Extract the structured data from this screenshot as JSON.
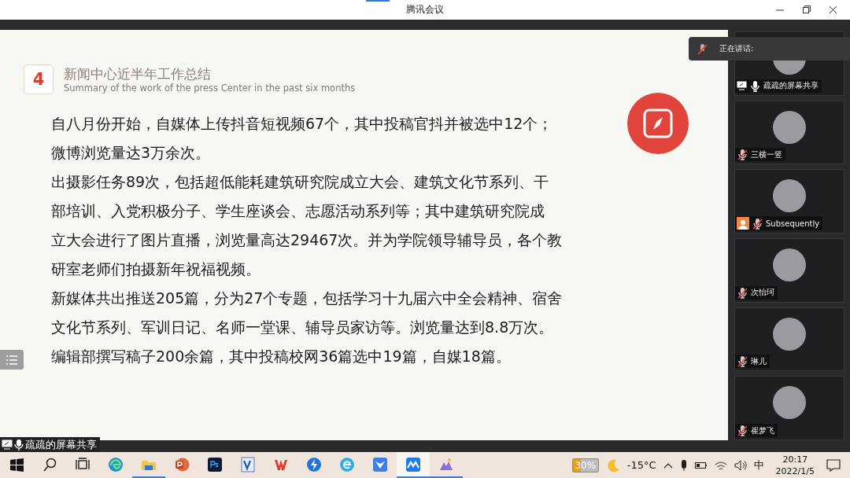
{
  "window": {
    "title": "腾讯会议"
  },
  "slide": {
    "number": "4",
    "title": "新闻中心近半年工作总结",
    "subtitle": "Summary of the work of the press Center in the past six months",
    "paragraphs": [
      {
        "lines": [
          "自八月份开始，自媒体上传抖音短视频67个，其中投稿官抖并被选中12个；",
          "微博浏览量达3万余次。"
        ]
      },
      {
        "lines": [
          "出摄影任务89次，包括超低能耗建筑研究院成立大会、建筑文化节系列、干",
          "部培训、入党积极分子、学生座谈会、志愿活动系列等；其中建筑研究院成",
          "立大会进行了图片直播，浏览量高达29467次。并为学院领导辅导员，各个教",
          "研室老师们拍摄新年祝福视频。"
        ]
      },
      {
        "lines": [
          "新媒体共出推送205篇，分为27个专题，包括学习十九届六中全会精神、宿舍",
          "文化节系列、军训日记、名师一堂课、辅导员家访等。浏览量达到8.8万次。"
        ]
      },
      {
        "lines": [
          "编辑部撰写稿子200余篇，其中投稿校网36篇选中19篇，自媒18篇。"
        ]
      }
    ]
  },
  "speaking_toast": {
    "label": "正在讲话:"
  },
  "participants": [
    {
      "name": "疏疏的屏幕共享",
      "muted": false,
      "sharing": true,
      "host": false
    },
    {
      "name": "三横一竖",
      "muted": true,
      "sharing": false,
      "host": false
    },
    {
      "name": "Subsequently",
      "muted": true,
      "sharing": false,
      "host": true
    },
    {
      "name": "次怡珂",
      "muted": true,
      "sharing": false,
      "host": false
    },
    {
      "name": "琳儿",
      "muted": true,
      "sharing": false,
      "host": false
    },
    {
      "name": "崔梦飞",
      "muted": true,
      "sharing": false,
      "host": false
    }
  ],
  "share_label": {
    "text": "疏疏的屏幕共享"
  },
  "taskbar": {
    "apps": [
      {
        "kind": "start",
        "running": false,
        "selected": false
      },
      {
        "kind": "search",
        "running": false,
        "selected": false
      },
      {
        "kind": "taskview",
        "running": false,
        "selected": false
      },
      {
        "kind": "browser",
        "running": false,
        "selected": false
      },
      {
        "kind": "folder",
        "running": true,
        "selected": false
      },
      {
        "kind": "slides",
        "running": false,
        "selected": false
      },
      {
        "kind": "photo",
        "running": false,
        "selected": false
      },
      {
        "kind": "diagram",
        "running": false,
        "selected": false
      },
      {
        "kind": "office",
        "running": false,
        "selected": false
      },
      {
        "kind": "bolt",
        "running": false,
        "selected": false
      },
      {
        "kind": "globe",
        "running": false,
        "selected": false
      },
      {
        "kind": "bird",
        "running": false,
        "selected": false
      },
      {
        "kind": "meeting",
        "running": true,
        "selected": true
      },
      {
        "kind": "mountain",
        "running": true,
        "selected": false
      }
    ],
    "battery_widget": "30%",
    "temperature": "-15°C",
    "ime": "中",
    "time": "20:17",
    "date": "2022/1/5"
  }
}
